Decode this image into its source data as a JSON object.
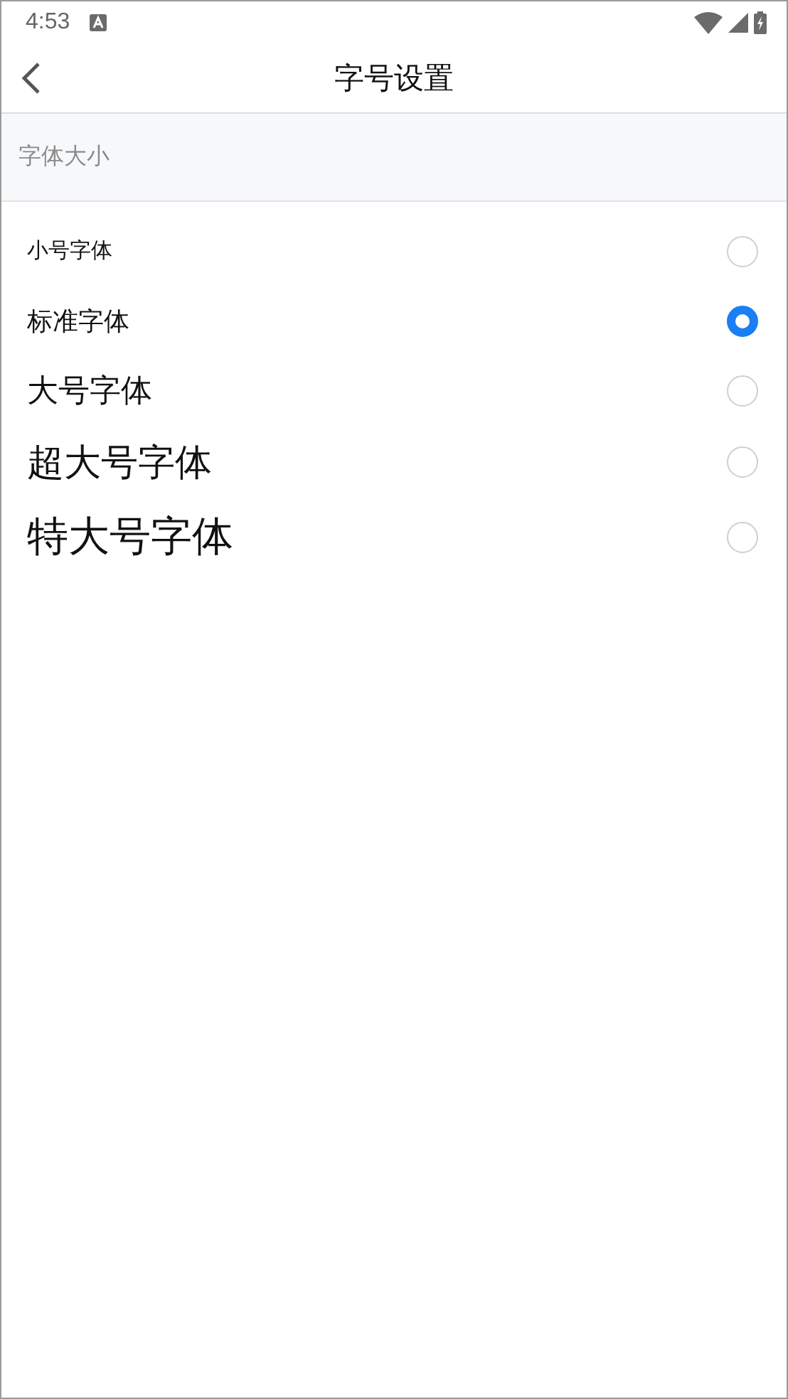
{
  "status_bar": {
    "time": "4:53"
  },
  "header": {
    "title": "字号设置"
  },
  "section": {
    "label": "字体大小"
  },
  "options": [
    {
      "label": "小号字体",
      "kind": "small",
      "selected": false
    },
    {
      "label": "标准字体",
      "kind": "standard",
      "selected": true
    },
    {
      "label": "大号字体",
      "kind": "large",
      "selected": false
    },
    {
      "label": "超大号字体",
      "kind": "xlarge",
      "selected": false
    },
    {
      "label": "特大号字体",
      "kind": "xxlarge",
      "selected": false
    }
  ]
}
